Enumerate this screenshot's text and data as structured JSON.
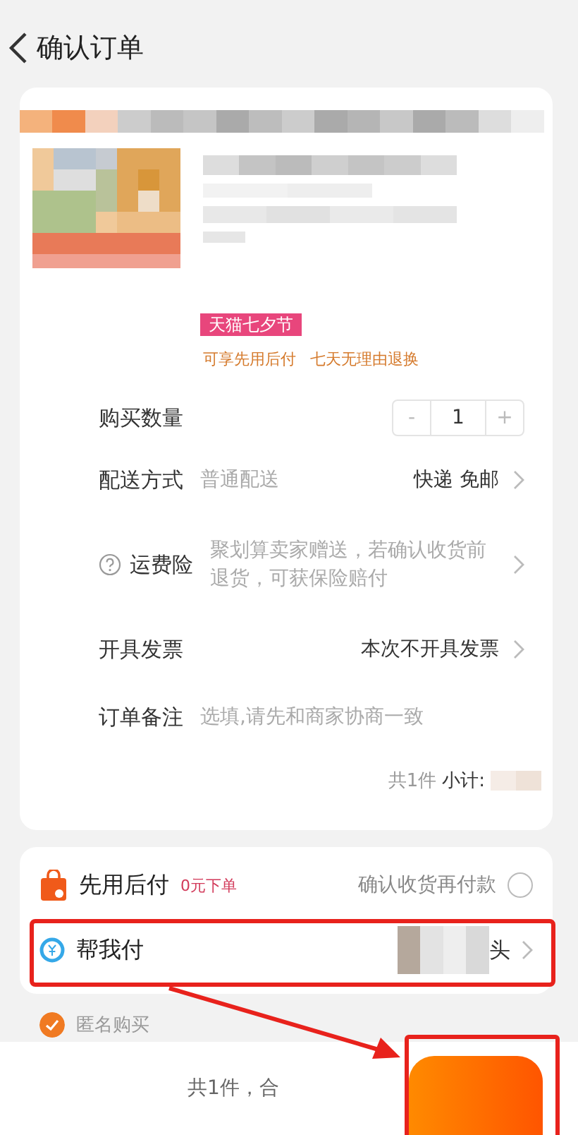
{
  "header": {
    "title": "确认订单"
  },
  "order_card": {
    "product": {
      "tag": "天猫七夕节",
      "services": [
        "可享先用后付",
        "七天无理由退换"
      ]
    },
    "quantity": {
      "label": "购买数量",
      "minus": "-",
      "value": "1",
      "plus": "+"
    },
    "rows": [
      {
        "kind": "link",
        "label": "配送方式",
        "detail": "普通配送",
        "value": "快递 免邮"
      },
      {
        "kind": "info",
        "label": "运费险",
        "detail": "聚划算卖家赠送，若确认收货前退货，可获保险赔付"
      },
      {
        "kind": "link",
        "label": "开具发票",
        "value": "本次不开具发票"
      },
      {
        "kind": "input",
        "label": "订单备注",
        "placeholder": "选填,请先和商家协商一致"
      }
    ],
    "subtotal": {
      "count": "共1件",
      "label": "小计:"
    }
  },
  "payment": {
    "options": [
      {
        "kind": "later",
        "label": "先用后付",
        "badge": "0元下单",
        "note": "确认收货再付款",
        "selected": false,
        "highlighted": false
      },
      {
        "kind": "friend",
        "label": "帮我付",
        "value": "头",
        "highlighted": true
      }
    ]
  },
  "anonymous": {
    "label": "匿名购买",
    "checked": true
  },
  "footer": {
    "summary": "共1件，合",
    "button_highlighted": true
  }
}
